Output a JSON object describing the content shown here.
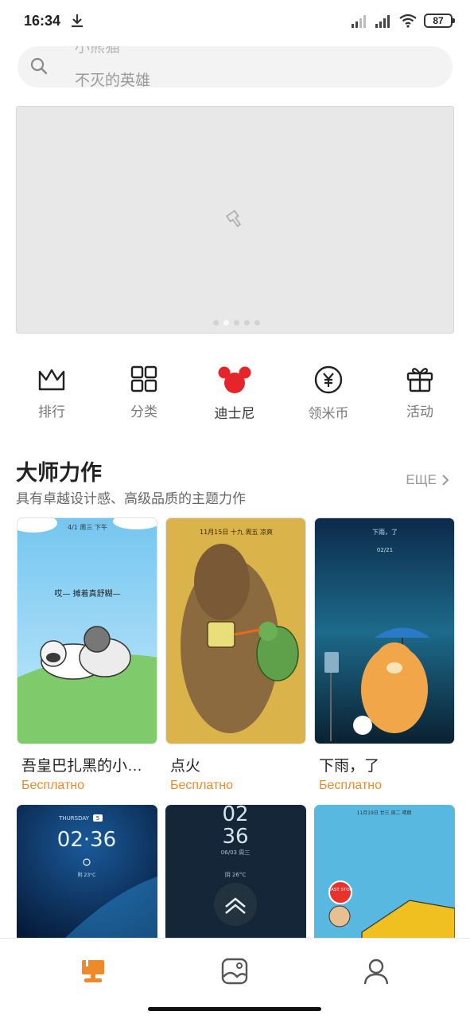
{
  "status_bar": {
    "time": "16:34",
    "battery": "87"
  },
  "search": {
    "previous_suggestion": "小熊猫",
    "placeholder": "不灭的英雄"
  },
  "quick_nav": [
    {
      "label": "排行",
      "icon": "crown-icon"
    },
    {
      "label": "分类",
      "icon": "grid-icon"
    },
    {
      "label": "迪士尼",
      "icon": "mickey-icon"
    },
    {
      "label": "领米币",
      "icon": "yen-coin-icon"
    },
    {
      "label": "活动",
      "icon": "gift-icon"
    }
  ],
  "section": {
    "title": "大师力作",
    "subtitle": "具有卓越设计感、高级品质的主题力作",
    "more_label": "ЕЩЕ"
  },
  "cards": [
    {
      "title": "吾皇巴扎黑的小日…",
      "price": "Бесплатно",
      "img_text_top": "4/1 周三 下午",
      "img_text_mid": "哎— 摊着真舒糊—"
    },
    {
      "title": "点火",
      "price": "Бесплатно",
      "img_text_top": "11月15日 十九 周五 凉爽"
    },
    {
      "title": "下雨，了",
      "price": "Бесплатно",
      "img_text_top": "下雨，了",
      "img_text_date": "02/21"
    }
  ],
  "cards_row2": [
    {
      "weekday": "THURSDAY",
      "day": "5",
      "time": "02·36",
      "weather": "阴  23°C"
    },
    {
      "hour": "02",
      "minute": "36",
      "date": "06/03 周三",
      "weather": "阴 26°C"
    },
    {
      "date": "11月19日 廿三 周二 晴朗",
      "sign": "LAST STOP"
    }
  ],
  "colors": {
    "accent": "#ee8a2a",
    "disney_red": "#e5252a"
  }
}
